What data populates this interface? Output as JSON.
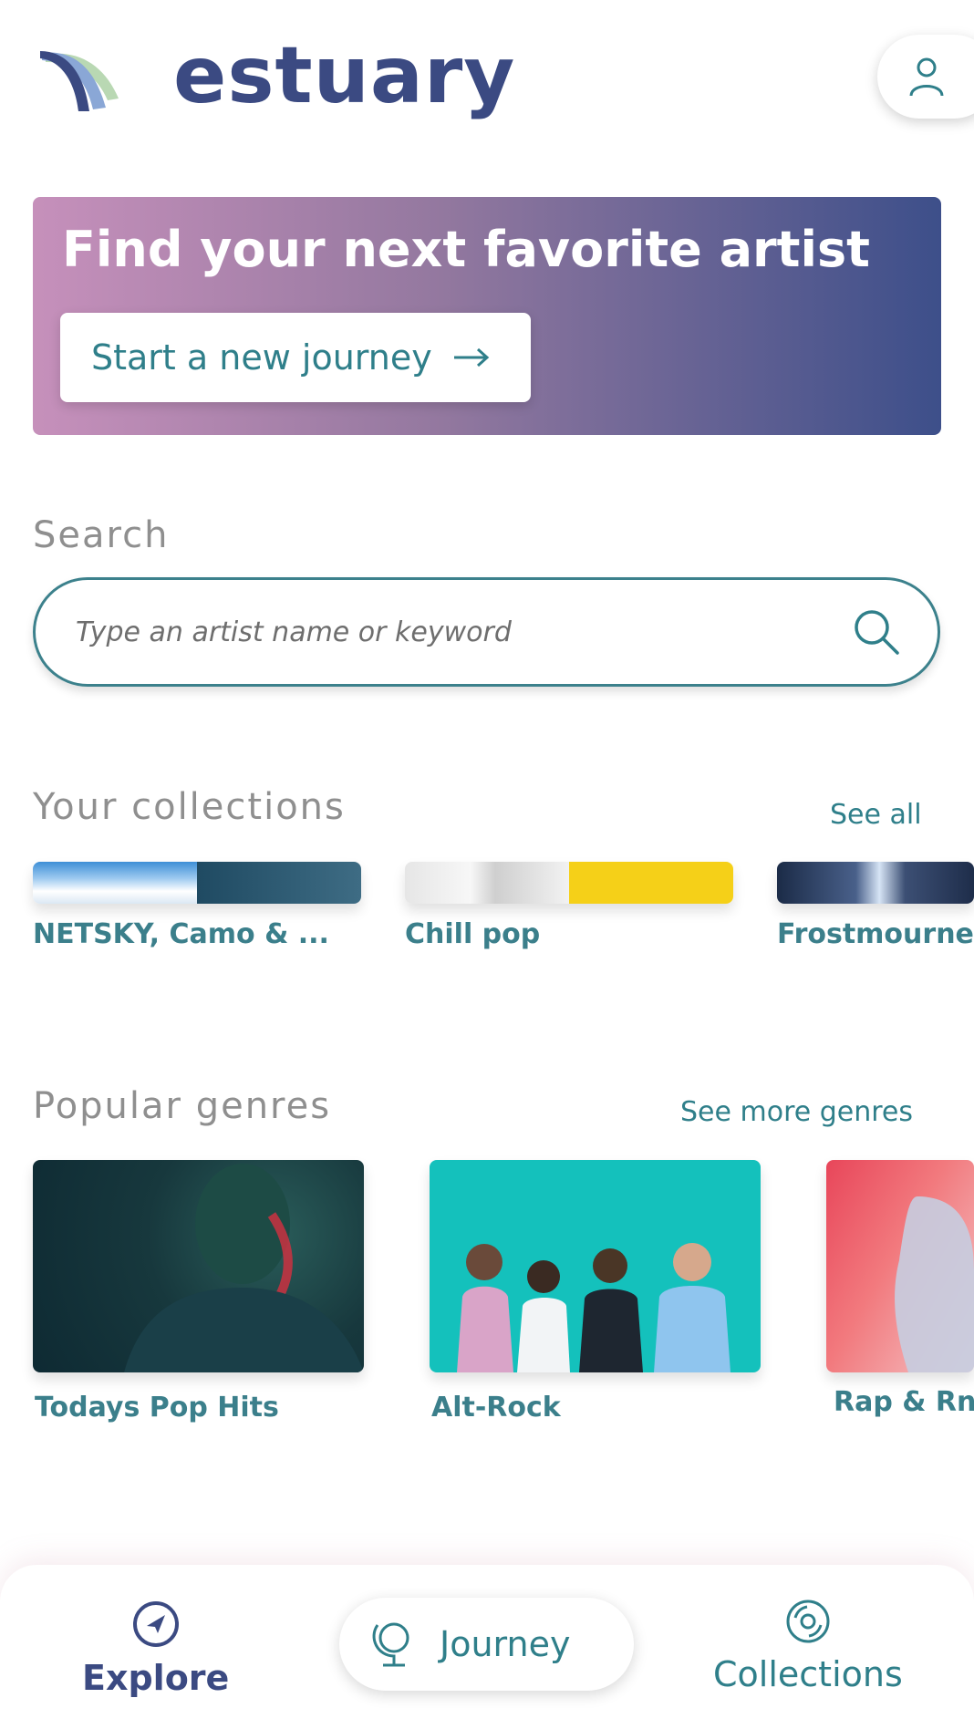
{
  "app": {
    "brand": "estuary"
  },
  "hero": {
    "title": "Find your next favorite artist",
    "button_label": "Start a new journey"
  },
  "search": {
    "label": "Search",
    "placeholder": "Type an artist name or keyword"
  },
  "collections": {
    "label": "Your collections",
    "see_all": "See all",
    "items": [
      {
        "name": "NETSKY, Camo & ..."
      },
      {
        "name": "Chill pop"
      },
      {
        "name": "Frostmourne"
      }
    ]
  },
  "genres": {
    "label": "Popular genres",
    "see_more": "See more genres",
    "items": [
      {
        "name": "Todays Pop Hits"
      },
      {
        "name": "Alt-Rock"
      },
      {
        "name": "Rap & RnB"
      }
    ]
  },
  "nav": {
    "explore": "Explore",
    "journey": "Journey",
    "collections": "Collections"
  },
  "colors": {
    "brand": "#3b4a82",
    "accent": "#2f7f8a",
    "hero_start": "#c690bb",
    "hero_end": "#3d4f8a"
  },
  "icons": [
    "logo-mark-icon",
    "user-icon",
    "arrow-right-icon",
    "search-icon",
    "compass-icon",
    "globe-icon",
    "disc-icon"
  ]
}
